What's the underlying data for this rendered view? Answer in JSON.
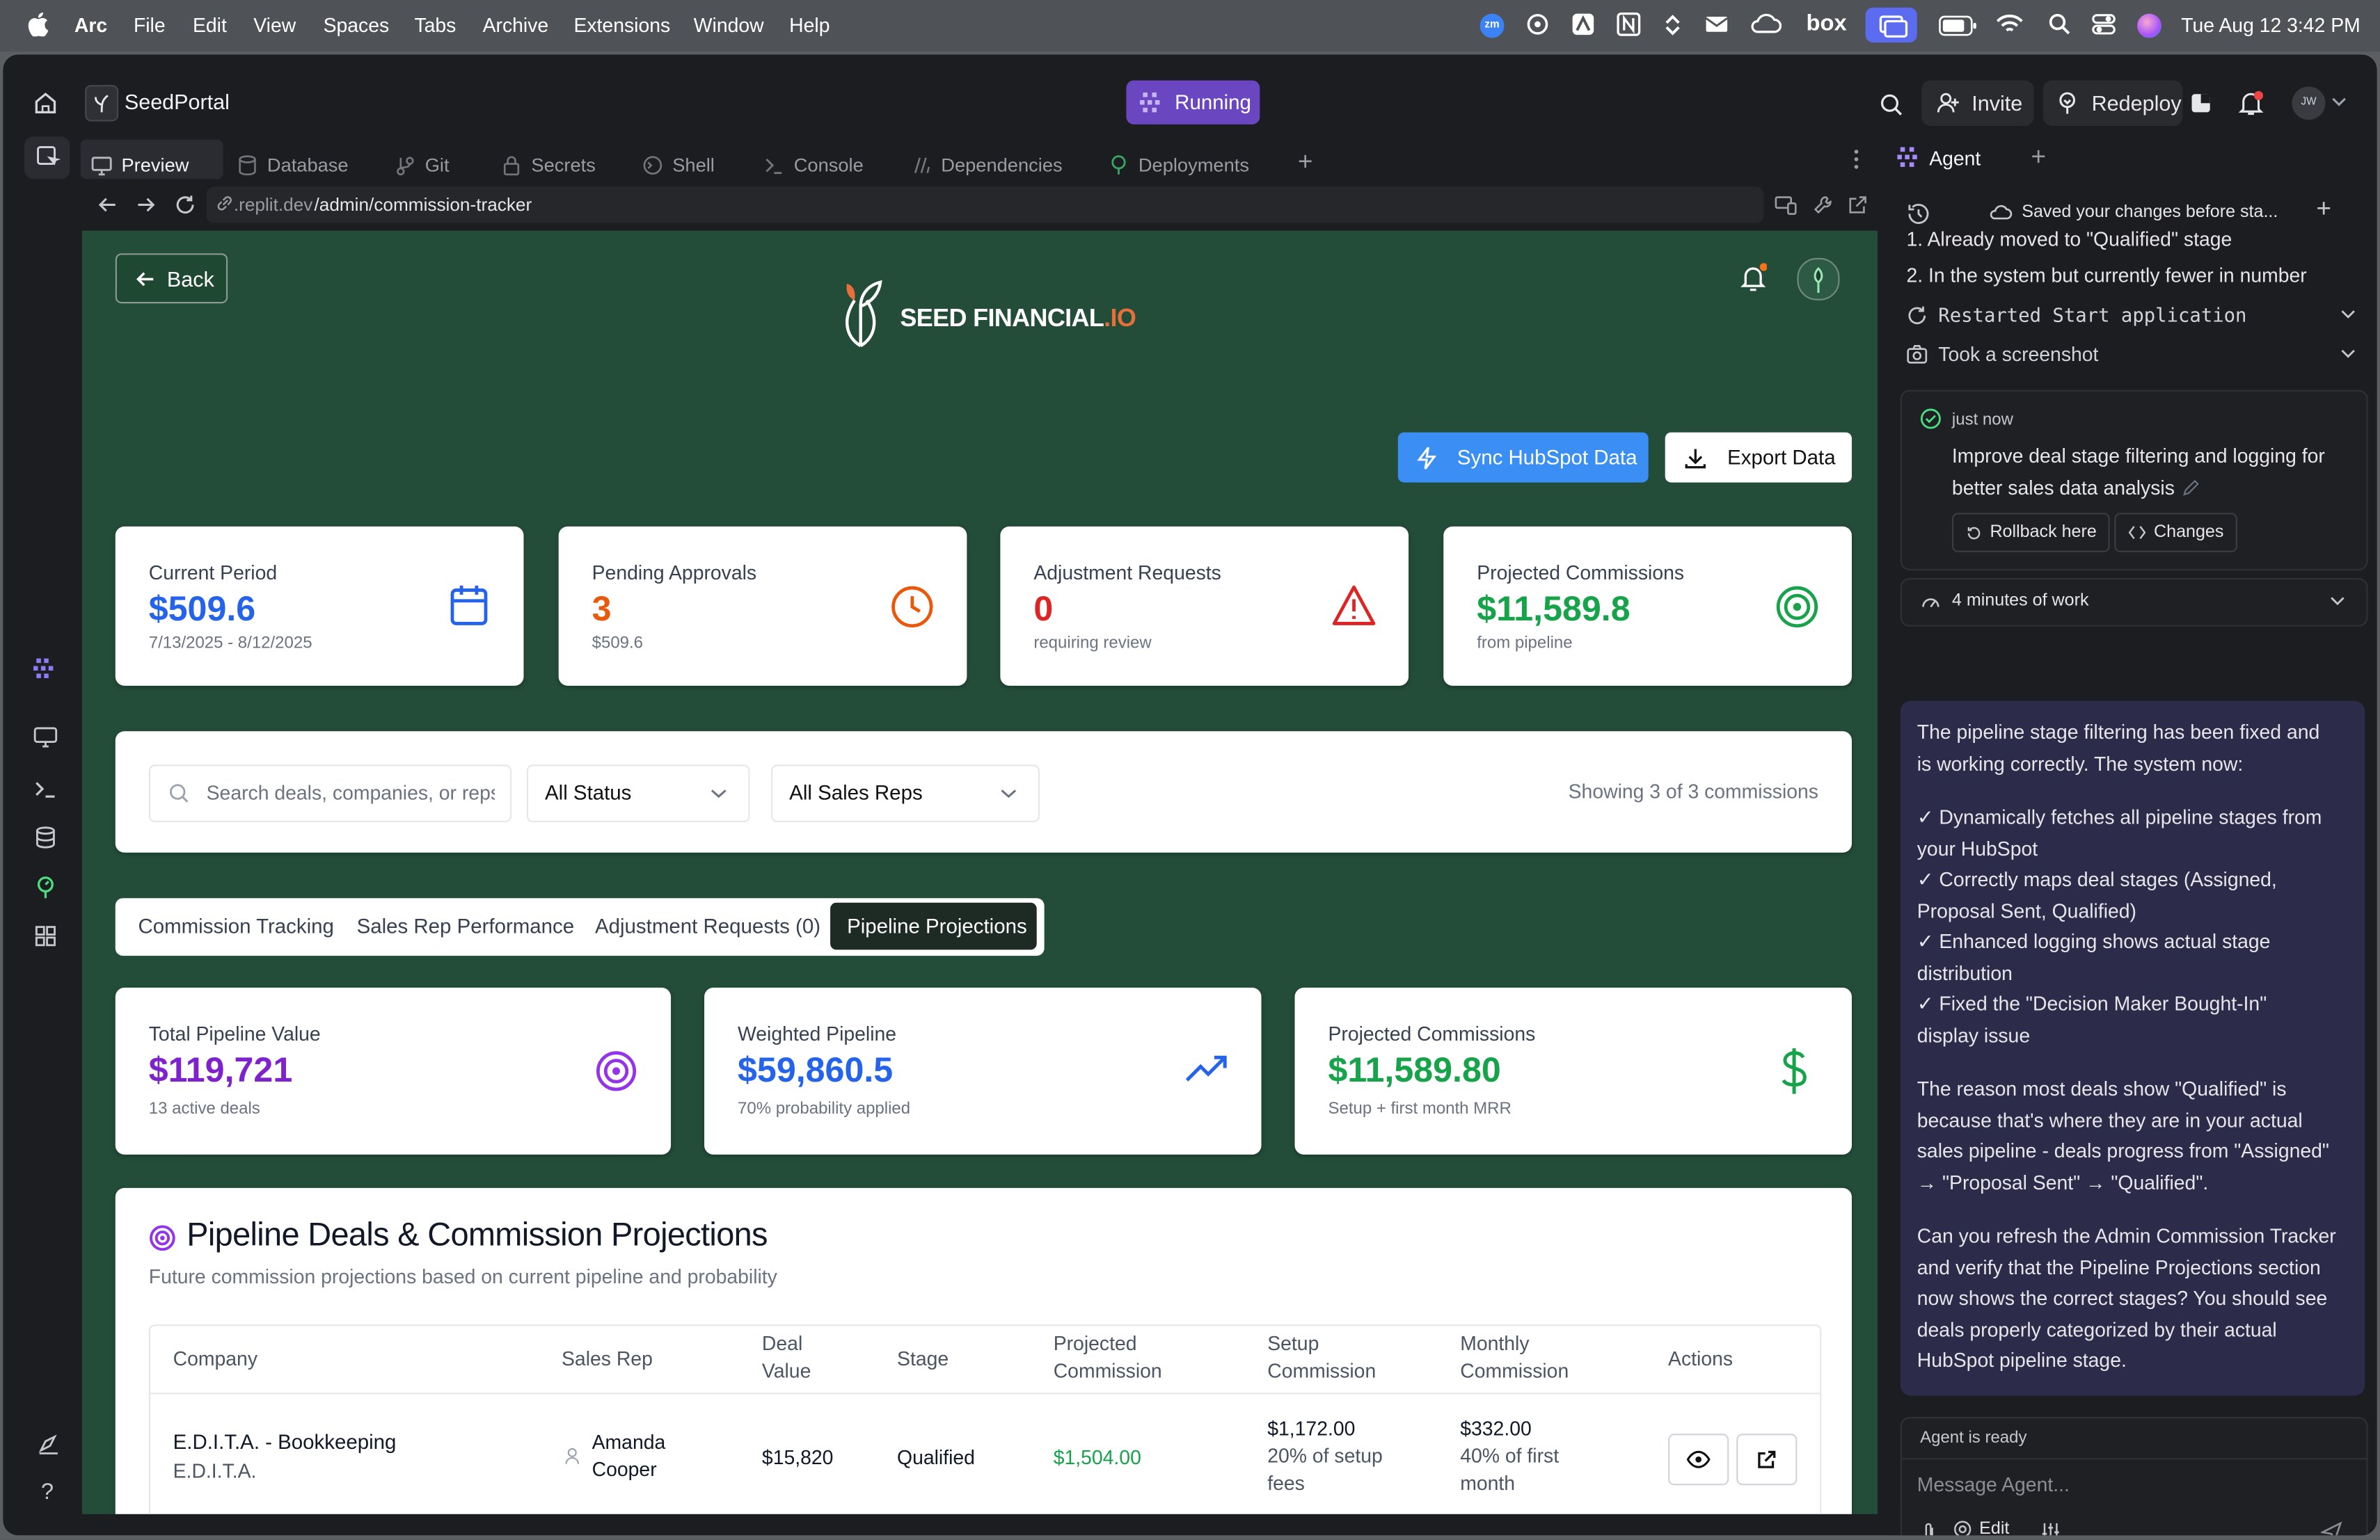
{
  "menubar": {
    "app": "Arc",
    "items": [
      "File",
      "Edit",
      "View",
      "Spaces",
      "Tabs",
      "Archive",
      "Extensions",
      "Window",
      "Help"
    ],
    "zoom_badge": "zm",
    "box_label": "box",
    "datetime": "Tue Aug 12  3:42 PM"
  },
  "topbar": {
    "project": "SeedPortal",
    "run_status": "Running",
    "invite": "Invite",
    "redeploy": "Redeploy",
    "avatar_initials": "JW"
  },
  "tabs": [
    "Preview",
    "Database",
    "Git",
    "Secrets",
    "Shell",
    "Console",
    "Dependencies",
    "Deployments"
  ],
  "url": {
    "prefix": ".replit.dev",
    "path": "/admin/commission-tracker"
  },
  "app": {
    "back": "Back",
    "brand_main": "SEED FINANCIAL",
    "brand_suffix": ".IO",
    "sync": "Sync HubSpot Data",
    "export": "Export Data",
    "stats": [
      {
        "label": "Current Period",
        "value": "$509.6",
        "sub": "7/13/2025 - 8/12/2025",
        "color": "#2563eb"
      },
      {
        "label": "Pending Approvals",
        "value": "3",
        "sub": "$509.6",
        "color": "#ea580c"
      },
      {
        "label": "Adjustment Requests",
        "value": "0",
        "sub": "requiring review",
        "color": "#dc2626"
      },
      {
        "label": "Projected Commissions",
        "value": "$11,589.8",
        "sub": "from pipeline",
        "color": "#16a34a"
      }
    ],
    "filters": {
      "search_placeholder": "Search deals, companies, or reps",
      "status": "All Status",
      "reps": "All Sales Reps",
      "showing": "Showing 3 of 3 commissions"
    },
    "view_tabs": [
      "Commission Tracking",
      "Sales Rep Performance",
      "Adjustment Requests (0)",
      "Pipeline Projections"
    ],
    "pipeline_stats": [
      {
        "label": "Total Pipeline Value",
        "value": "$119,721",
        "sub": "13 active deals",
        "color": "#7e22ce"
      },
      {
        "label": "Weighted Pipeline",
        "value": "$59,860.5",
        "sub": "70% probability applied",
        "color": "#2563eb"
      },
      {
        "label": "Projected Commissions",
        "value": "$11,589.80",
        "sub": "Setup + first month MRR",
        "color": "#16a34a"
      }
    ],
    "deals_section": {
      "title": "Pipeline Deals & Commission Projections",
      "subtitle": "Future commission projections based on current pipeline and probability",
      "headers": {
        "company": "Company",
        "rep": "Sales Rep",
        "deal_value": [
          "Deal",
          "Value"
        ],
        "stage": "Stage",
        "projected": [
          "Projected",
          "Commission"
        ],
        "setup": [
          "Setup",
          "Commission"
        ],
        "monthly": [
          "Monthly",
          "Commission"
        ],
        "actions": "Actions"
      },
      "rows": [
        {
          "company": "E.D.I.T.A. - Bookkeeping",
          "company_sub": "E.D.I.T.A.",
          "rep": [
            "Amanda",
            "Cooper"
          ],
          "deal_value": "$15,820",
          "stage": "Qualified",
          "projected": "$1,504.00",
          "setup": [
            "$1,172.00",
            "20% of setup",
            "fees"
          ],
          "monthly": [
            "$332.00",
            "40% of first",
            "month"
          ]
        }
      ]
    }
  },
  "agent": {
    "tab": "Agent",
    "saved_notice": "Saved your changes before sta...",
    "list": [
      "1. Already moved to \"Qualified\" stage",
      "2. In the system but currently fewer in number"
    ],
    "actions": [
      "Restarted Start application",
      "Took a screenshot"
    ],
    "checkpoint": {
      "time": "just now",
      "text": [
        "Improve deal stage filtering and logging for",
        "better sales data analysis"
      ],
      "rollback": "Rollback here",
      "changes": "Changes"
    },
    "work": "4 minutes of work",
    "message": {
      "p1": [
        "The pipeline stage filtering has been fixed and",
        "is working correctly. The system now:"
      ],
      "checks": [
        [
          "✓ Dynamically fetches all pipeline stages from",
          "your HubSpot"
        ],
        [
          "✓ Correctly maps deal stages (Assigned,",
          "Proposal Sent, Qualified)"
        ],
        [
          "✓ Enhanced logging shows actual stage",
          "distribution"
        ],
        [
          "✓ Fixed the \"Decision Maker Bought-In\"",
          "display issue"
        ]
      ],
      "p2": [
        "The reason most deals show \"Qualified\" is",
        "because that's where they are in your actual",
        "sales pipeline - deals progress from \"Assigned\"",
        "→ \"Proposal Sent\" → \"Qualified\"."
      ],
      "p3": [
        "Can you refresh the Admin Commission Tracker",
        "and verify that the Pipeline Projections section",
        "now shows the correct stages? You should see",
        "deals properly categorized by their actual",
        "HubSpot pipeline stage."
      ]
    },
    "status": "Agent is ready",
    "input_placeholder": "Message Agent...",
    "edit": "Edit"
  }
}
